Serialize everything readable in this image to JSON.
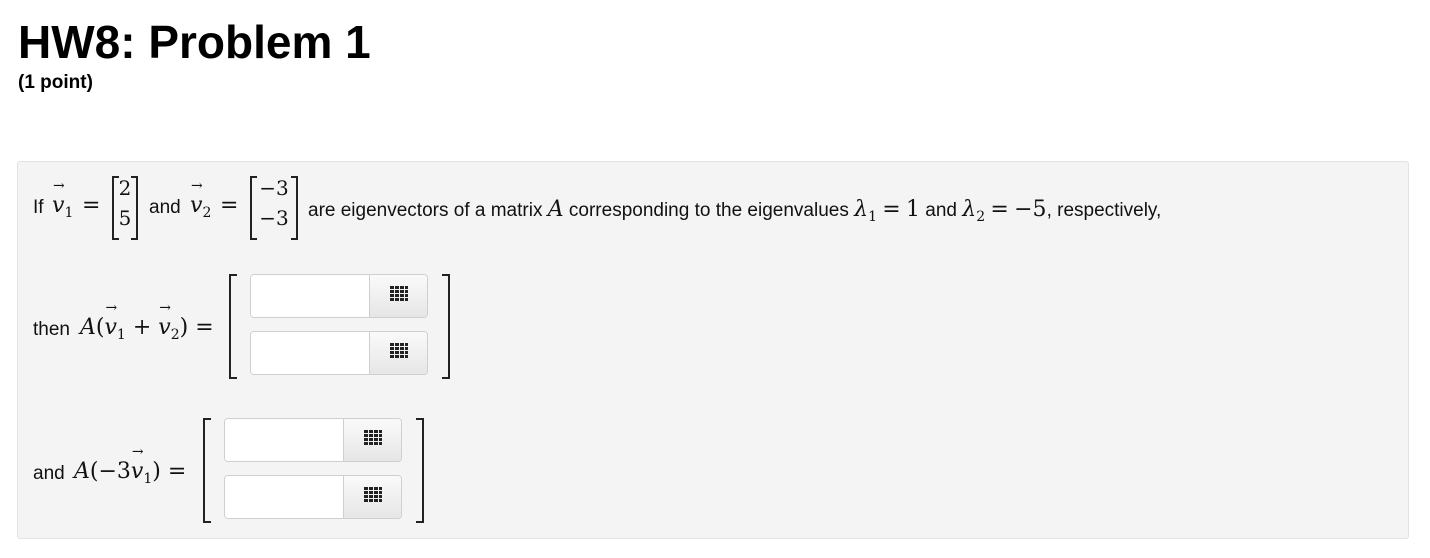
{
  "header": {
    "title": "HW8: Problem 1",
    "points": "(1 point)"
  },
  "problem": {
    "line1": {
      "if": "If",
      "v1_symbol": "v",
      "v1_sub": "1",
      "equals": "=",
      "v1_entries": [
        "2",
        "5"
      ],
      "and": "and",
      "v2_symbol": "v",
      "v2_sub": "2",
      "v2_entries": [
        "−3",
        "−3"
      ],
      "middle_text": "are eigenvectors of a matrix",
      "matrix_symbol": "A",
      "corr_text": "corresponding to the eigenvalues",
      "lambda_symbol": "λ",
      "lambda1_sub": "1",
      "lambda1_value": "1",
      "lambda2_sub": "2",
      "lambda2_value": "−5",
      "tail": ", respectively,"
    },
    "line2": {
      "then": "then",
      "expr_A": "A",
      "open_paren": "(",
      "plus": "+",
      "close_paren": ")",
      "equals": "="
    },
    "line3": {
      "and": "and",
      "expr_A": "A",
      "open_paren": "(−3",
      "close_paren": ")",
      "equals": "="
    }
  },
  "answers": {
    "a1": {
      "value": "",
      "placeholder": ""
    },
    "a2": {
      "value": "",
      "placeholder": ""
    },
    "b1": {
      "value": "",
      "placeholder": ""
    },
    "b2": {
      "value": "",
      "placeholder": ""
    },
    "tool_icon": "grid-icon",
    "tool_color": "#222222"
  }
}
